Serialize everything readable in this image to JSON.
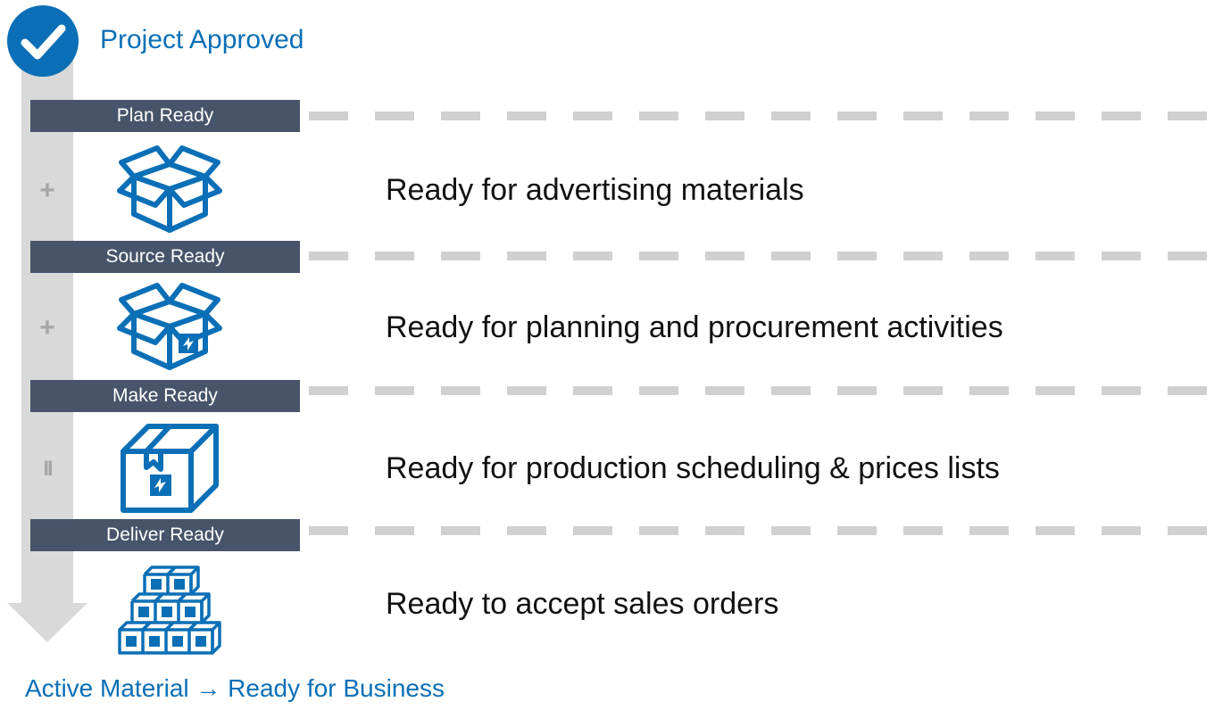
{
  "header": {
    "badge_icon": "check-circle-icon",
    "title": "Project Approved"
  },
  "stages": [
    {
      "label": "Plan Ready"
    },
    {
      "label": "Source Ready"
    },
    {
      "label": "Make Ready"
    },
    {
      "label": "Deliver Ready"
    }
  ],
  "rows": [
    {
      "glyph": "+",
      "icon": "open-box-icon",
      "text": "Ready for advertising materials"
    },
    {
      "glyph": "+",
      "icon": "open-box-sync-icon",
      "text": "Ready for planning and procurement activities"
    },
    {
      "glyph": "II",
      "icon": "closed-box-sync-icon",
      "text": "Ready for production scheduling & prices lists"
    },
    {
      "icon": "stacked-boxes-icon",
      "text": "Ready to accept sales orders"
    }
  ],
  "footer": {
    "text": "Active Material → Ready for Business"
  },
  "colors": {
    "accent": "#0a6fb6",
    "bar": "#47546a",
    "flow": "#d9d9d9",
    "dash": "#d0d0d0"
  }
}
